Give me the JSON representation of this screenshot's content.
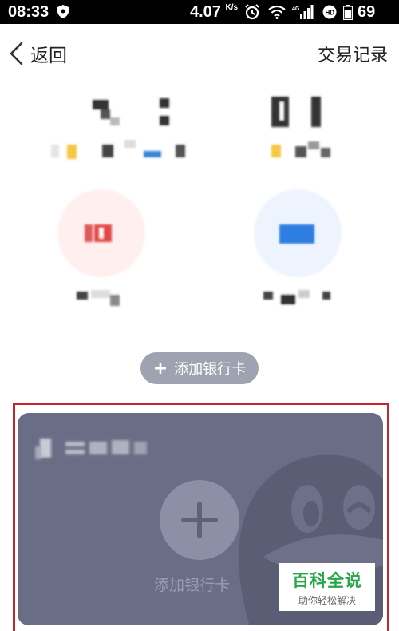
{
  "status_bar": {
    "time": "08:33",
    "net_speed": "4.07",
    "net_speed_unit": "K/s",
    "network_type": "4G",
    "battery": "69"
  },
  "nav": {
    "back_label": "返回",
    "history_label": "交易记录"
  },
  "actions": {
    "add_bank_card_pill": "添加银行卡",
    "add_bank_card_card": "添加银行卡"
  },
  "colors": {
    "card_bg": "#6a6d86",
    "pill_bg": "#9ea3b2",
    "highlight": "#c1272d",
    "watermark_green": "#2aa64a"
  },
  "icons": {
    "back": "chevron-left-icon",
    "plus": "plus-icon",
    "shield": "shield-icon",
    "alarm": "alarm-icon",
    "wifi": "wifi-icon",
    "signal": "signal-icon",
    "battery": "battery-icon",
    "penguin": "penguin-icon"
  },
  "watermark": {
    "title": "百科全说",
    "subtitle": "助你轻松解决"
  }
}
